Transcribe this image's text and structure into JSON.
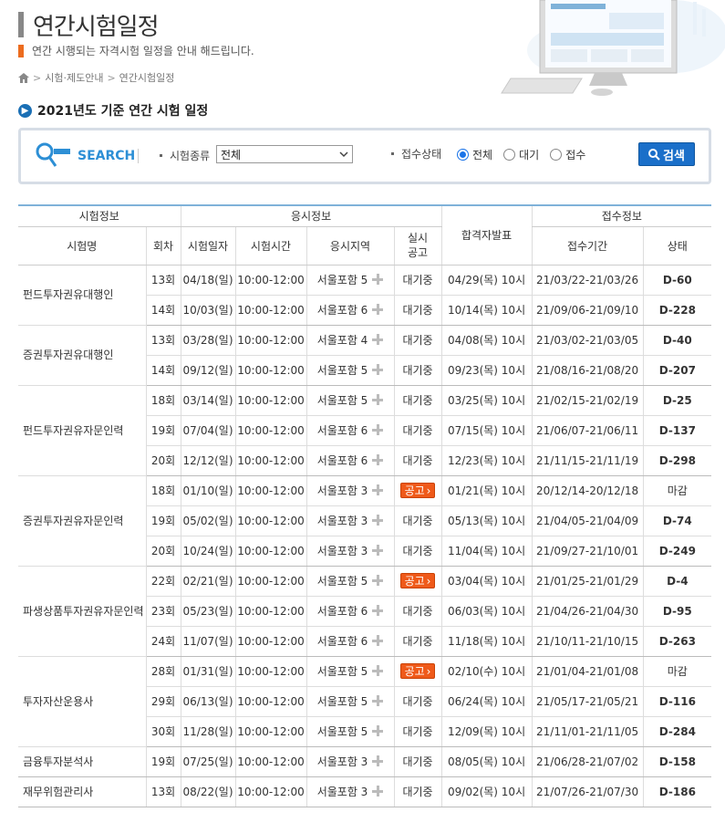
{
  "header": {
    "title": "연간시험일정",
    "subtitle": "연간 시행되는 자격시험 일정을 안내 해드립니다.",
    "breadcrumb": [
      "시험·제도안내",
      "연간시험일정"
    ]
  },
  "section_title": "2021년도 기준 연간 시험 일정",
  "search": {
    "logo_text": "SEARCH",
    "exam_type_label": "시험종류",
    "exam_type_value": "전체",
    "status_label": "접수상태",
    "status_options": [
      {
        "label": "전체",
        "checked": true
      },
      {
        "label": "대기",
        "checked": false
      },
      {
        "label": "접수",
        "checked": false
      }
    ],
    "button_label": "검색"
  },
  "table": {
    "group_headers": [
      "시험정보",
      "응시정보",
      "합격자발표",
      "접수정보"
    ],
    "columns": [
      "시험명",
      "회차",
      "시험일자",
      "시험시간",
      "응시지역",
      "실시\n공고",
      "접수기간",
      "상태"
    ],
    "groups": [
      {
        "name": "펀드투자권유대행인",
        "rows": [
          {
            "round": "13회",
            "date": "04/18(일)",
            "time": "10:00-12:00",
            "region": "서울포함 5",
            "notice": "대기중",
            "result": "04/29(목) 10시",
            "period": "21/03/22-21/03/26",
            "status": "D-60"
          },
          {
            "round": "14회",
            "date": "10/03(일)",
            "time": "10:00-12:00",
            "region": "서울포함 6",
            "notice": "대기중",
            "result": "10/14(목) 10시",
            "period": "21/09/06-21/09/10",
            "status": "D-228"
          }
        ]
      },
      {
        "name": "증권투자권유대행인",
        "rows": [
          {
            "round": "13회",
            "date": "03/28(일)",
            "time": "10:00-12:00",
            "region": "서울포함 4",
            "notice": "대기중",
            "result": "04/08(목) 10시",
            "period": "21/03/02-21/03/05",
            "status": "D-40"
          },
          {
            "round": "14회",
            "date": "09/12(일)",
            "time": "10:00-12:00",
            "region": "서울포함 5",
            "notice": "대기중",
            "result": "09/23(목) 10시",
            "period": "21/08/16-21/08/20",
            "status": "D-207"
          }
        ]
      },
      {
        "name": "펀드투자권유자문인력",
        "rows": [
          {
            "round": "18회",
            "date": "03/14(일)",
            "time": "10:00-12:00",
            "region": "서울포함 5",
            "notice": "대기중",
            "result": "03/25(목) 10시",
            "period": "21/02/15-21/02/19",
            "status": "D-25"
          },
          {
            "round": "19회",
            "date": "07/04(일)",
            "time": "10:00-12:00",
            "region": "서울포함 6",
            "notice": "대기중",
            "result": "07/15(목) 10시",
            "period": "21/06/07-21/06/11",
            "status": "D-137"
          },
          {
            "round": "20회",
            "date": "12/12(일)",
            "time": "10:00-12:00",
            "region": "서울포함 6",
            "notice": "대기중",
            "result": "12/23(목) 10시",
            "period": "21/11/15-21/11/19",
            "status": "D-298"
          }
        ]
      },
      {
        "name": "증권투자권유자문인력",
        "rows": [
          {
            "round": "18회",
            "date": "01/10(일)",
            "time": "10:00-12:00",
            "region": "서울포함 3",
            "notice": "공고",
            "result": "01/21(목) 10시",
            "period": "20/12/14-20/12/18",
            "status": "마감"
          },
          {
            "round": "19회",
            "date": "05/02(일)",
            "time": "10:00-12:00",
            "region": "서울포함 3",
            "notice": "대기중",
            "result": "05/13(목) 10시",
            "period": "21/04/05-21/04/09",
            "status": "D-74"
          },
          {
            "round": "20회",
            "date": "10/24(일)",
            "time": "10:00-12:00",
            "region": "서울포함 3",
            "notice": "대기중",
            "result": "11/04(목) 10시",
            "period": "21/09/27-21/10/01",
            "status": "D-249"
          }
        ]
      },
      {
        "name": "파생상품투자권유자문인력",
        "rows": [
          {
            "round": "22회",
            "date": "02/21(일)",
            "time": "10:00-12:00",
            "region": "서울포함 5",
            "notice": "공고",
            "result": "03/04(목) 10시",
            "period": "21/01/25-21/01/29",
            "status": "D-4"
          },
          {
            "round": "23회",
            "date": "05/23(일)",
            "time": "10:00-12:00",
            "region": "서울포함 6",
            "notice": "대기중",
            "result": "06/03(목) 10시",
            "period": "21/04/26-21/04/30",
            "status": "D-95"
          },
          {
            "round": "24회",
            "date": "11/07(일)",
            "time": "10:00-12:00",
            "region": "서울포함 6",
            "notice": "대기중",
            "result": "11/18(목) 10시",
            "period": "21/10/11-21/10/15",
            "status": "D-263"
          }
        ]
      },
      {
        "name": "투자자산운용사",
        "rows": [
          {
            "round": "28회",
            "date": "01/31(일)",
            "time": "10:00-12:00",
            "region": "서울포함 5",
            "notice": "공고",
            "result": "02/10(수) 10시",
            "period": "21/01/04-21/01/08",
            "status": "마감"
          },
          {
            "round": "29회",
            "date": "06/13(일)",
            "time": "10:00-12:00",
            "region": "서울포함 5",
            "notice": "대기중",
            "result": "06/24(목) 10시",
            "period": "21/05/17-21/05/21",
            "status": "D-116"
          },
          {
            "round": "30회",
            "date": "11/28(일)",
            "time": "10:00-12:00",
            "region": "서울포함 5",
            "notice": "대기중",
            "result": "12/09(목) 10시",
            "period": "21/11/01-21/11/05",
            "status": "D-284"
          }
        ]
      },
      {
        "name": "금융투자분석사",
        "rows": [
          {
            "round": "19회",
            "date": "07/25(일)",
            "time": "10:00-12:00",
            "region": "서울포함 3",
            "notice": "대기중",
            "result": "08/05(목) 10시",
            "period": "21/06/28-21/07/02",
            "status": "D-158"
          }
        ]
      },
      {
        "name": "재무위험관리사",
        "rows": [
          {
            "round": "13회",
            "date": "08/22(일)",
            "time": "10:00-12:00",
            "region": "서울포함 3",
            "notice": "대기중",
            "result": "09/02(목) 10시",
            "period": "21/07/26-21/07/30",
            "status": "D-186"
          }
        ]
      }
    ]
  }
}
